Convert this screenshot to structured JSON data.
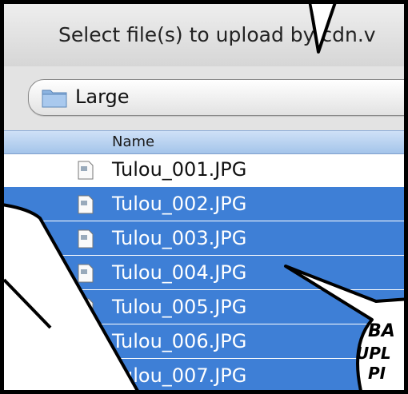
{
  "dialog": {
    "title": "Select file(s) to upload by cdn.v"
  },
  "pathbar": {
    "location": "Large",
    "icon": "folder-icon"
  },
  "list": {
    "header": "Name",
    "files": [
      {
        "name": "Tulou_001.JPG",
        "selected": false
      },
      {
        "name": "Tulou_002.JPG",
        "selected": true
      },
      {
        "name": "Tulou_003.JPG",
        "selected": true
      },
      {
        "name": "Tulou_004.JPG",
        "selected": true
      },
      {
        "name": "Tulou_005.JPG",
        "selected": true
      },
      {
        "name": "Tulou_006.JPG",
        "selected": true
      },
      {
        "name": "Tulou_007.JPG",
        "selected": true
      }
    ]
  },
  "comic": {
    "caption_lines": [
      "BA",
      "UPL",
      "PI"
    ]
  },
  "colors": {
    "selection": "#3e7fd6",
    "header": "#b8d2f0"
  }
}
